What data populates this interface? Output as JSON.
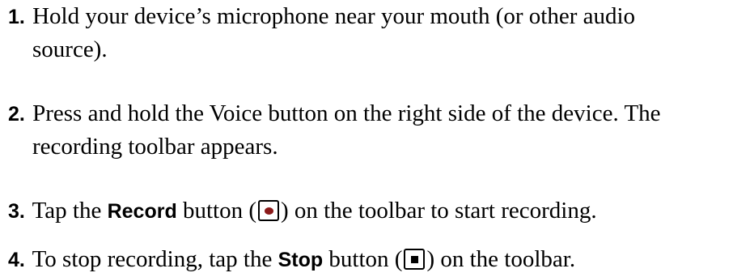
{
  "steps": [
    {
      "number": "1.",
      "line1": "Hold your device’s microphone near your mouth (or other audio",
      "line2": "source)."
    },
    {
      "number": "2.",
      "line1": "Press and hold the Voice button on the right side of the device. The",
      "line2": "recording toolbar appears."
    },
    {
      "number": "3.",
      "before": "Tap the",
      "bold": "Record",
      "middle": "button (",
      "icon": "record-icon",
      "after": ") on the toolbar to start recording."
    },
    {
      "number": "4.",
      "before": "To stop recording, tap the",
      "bold": "Stop",
      "middle": "button (",
      "icon": "stop-icon",
      "after": ") on the toolbar."
    }
  ],
  "colors": {
    "text": "#000000",
    "record_dot": "#8b1a1a"
  }
}
